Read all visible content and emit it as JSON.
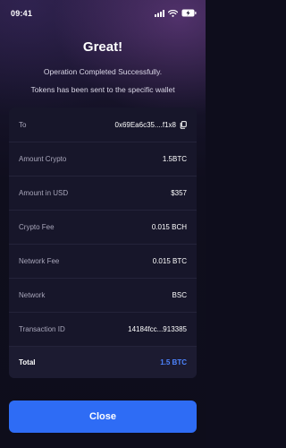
{
  "status_bar": {
    "time": "09:41"
  },
  "header": {
    "title": "Great!",
    "subtitle_line1": "Operation Completed Successfully.",
    "subtitle_line2": "Tokens has been sent to the specific wallet"
  },
  "details": {
    "to": {
      "label": "To",
      "value": "0x69Ea6c35....f1x8"
    },
    "amount_crypto": {
      "label": "Amount Crypto",
      "value": "1.5BTC"
    },
    "amount_usd": {
      "label": "Amount in USD",
      "value": "$357"
    },
    "crypto_fee": {
      "label": "Crypto Fee",
      "value": "0.015 BCH"
    },
    "network_fee": {
      "label": "Network Fee",
      "value": "0.015 BTC"
    },
    "network": {
      "label": "Network",
      "value": "BSC"
    },
    "transaction_id": {
      "label": "Transaction ID",
      "value": "14184fcc...913385"
    },
    "total": {
      "label": "Total",
      "value": "1.5 BTC"
    }
  },
  "close_button": {
    "label": "Close"
  },
  "icons": {
    "signal": "signal-icon",
    "wifi": "wifi-icon",
    "battery": "battery-charging-icon",
    "copy": "copy-icon"
  },
  "colors": {
    "accent": "#2e6cf5",
    "total_value": "#4d84ff",
    "card_background": "#17162a",
    "page_background": "#0e0d1c"
  }
}
